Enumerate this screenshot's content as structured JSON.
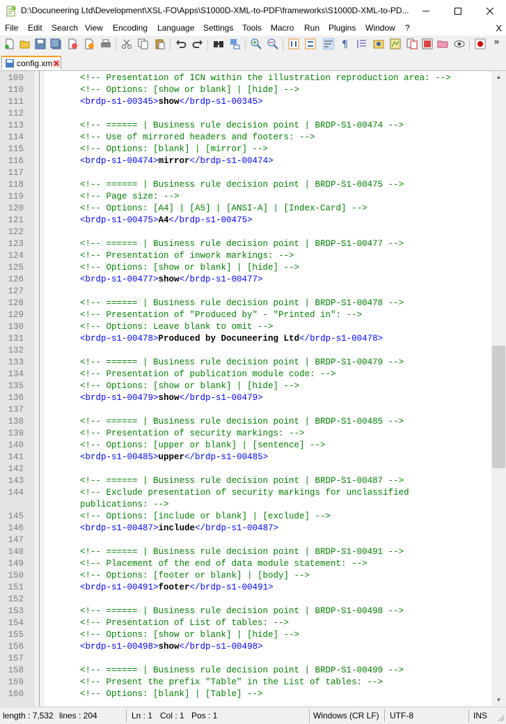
{
  "window": {
    "title": "D:\\Docuneering Ltd\\Development\\XSL-FO\\Apps\\S1000D-XML-to-PDF\\frameworks\\S1000D-XML-to-PD...",
    "minimize_icon": "minimize-icon",
    "maximize_icon": "maximize-icon",
    "close_icon": "close-icon"
  },
  "menu": {
    "items": [
      "File",
      "Edit",
      "Search",
      "View",
      "Encoding",
      "Language",
      "Settings",
      "Tools",
      "Macro",
      "Run",
      "Plugins",
      "Window",
      "?"
    ],
    "close_label": "X"
  },
  "toolbar": {
    "icons": [
      "new-file-icon",
      "open-file-icon",
      "save-icon",
      "save-all-icon",
      "close-icon",
      "close-all-icon",
      "print-icon",
      "cut-icon",
      "copy-icon",
      "paste-icon",
      "undo-icon",
      "redo-icon",
      "find-icon",
      "replace-icon",
      "zoom-in-icon",
      "zoom-out-icon",
      "sync-vertical-icon",
      "sync-horizontal-icon",
      "word-wrap-icon",
      "show-all-chars-icon",
      "indent-guide-icon",
      "udl-icon",
      "doc-map-icon",
      "function-list-icon",
      "folder-workspace-icon",
      "monitoring-icon",
      "record-macro-icon"
    ],
    "overflow": "»"
  },
  "tabs": [
    {
      "label": "config.xml",
      "active": true
    }
  ],
  "editor": {
    "lines": [
      {
        "n": "109",
        "parts": [
          {
            "t": "c",
            "s": "<!-- Presentation of ICN within the illustration reproduction area: -->"
          }
        ]
      },
      {
        "n": "110",
        "parts": [
          {
            "t": "c",
            "s": "<!-- Options: [show or blank] | [hide] -->"
          }
        ]
      },
      {
        "n": "111",
        "parts": [
          {
            "t": "t",
            "s": "<brdp-s1-00345>"
          },
          {
            "t": "v",
            "s": "show"
          },
          {
            "t": "t",
            "s": "</brdp-s1-00345>"
          }
        ]
      },
      {
        "n": "112",
        "parts": []
      },
      {
        "n": "113",
        "parts": [
          {
            "t": "c",
            "s": "<!-- ====== | Business rule decision point | BRDP-S1-00474 -->"
          }
        ]
      },
      {
        "n": "114",
        "parts": [
          {
            "t": "c",
            "s": "<!-- Use of mirrored headers and footers: -->"
          }
        ]
      },
      {
        "n": "115",
        "parts": [
          {
            "t": "c",
            "s": "<!-- Options: [blank] | [mirror] -->"
          }
        ]
      },
      {
        "n": "116",
        "parts": [
          {
            "t": "t",
            "s": "<brdp-s1-00474>"
          },
          {
            "t": "v",
            "s": "mirror"
          },
          {
            "t": "t",
            "s": "</brdp-s1-00474>"
          }
        ]
      },
      {
        "n": "117",
        "parts": []
      },
      {
        "n": "118",
        "parts": [
          {
            "t": "c",
            "s": "<!-- ====== | Business rule decision point | BRDP-S1-00475 -->"
          }
        ]
      },
      {
        "n": "119",
        "parts": [
          {
            "t": "c",
            "s": "<!-- Page size: -->"
          }
        ]
      },
      {
        "n": "120",
        "parts": [
          {
            "t": "c",
            "s": "<!-- Options: [A4] | [A5] | [ANSI-A] | [Index-Card] -->"
          }
        ]
      },
      {
        "n": "121",
        "parts": [
          {
            "t": "t",
            "s": "<brdp-s1-00475>"
          },
          {
            "t": "v",
            "s": "A4"
          },
          {
            "t": "t",
            "s": "</brdp-s1-00475>"
          }
        ]
      },
      {
        "n": "122",
        "parts": []
      },
      {
        "n": "123",
        "parts": [
          {
            "t": "c",
            "s": "<!-- ====== | Business rule decision point | BRDP-S1-00477 -->"
          }
        ]
      },
      {
        "n": "124",
        "parts": [
          {
            "t": "c",
            "s": "<!-- Presentation of inwork markings: -->"
          }
        ]
      },
      {
        "n": "125",
        "parts": [
          {
            "t": "c",
            "s": "<!-- Options: [show or blank] | [hide] -->"
          }
        ]
      },
      {
        "n": "126",
        "parts": [
          {
            "t": "t",
            "s": "<brdp-s1-00477>"
          },
          {
            "t": "v",
            "s": "show"
          },
          {
            "t": "t",
            "s": "</brdp-s1-00477>"
          }
        ]
      },
      {
        "n": "127",
        "parts": []
      },
      {
        "n": "128",
        "parts": [
          {
            "t": "c",
            "s": "<!-- ====== | Business rule decision point | BRDP-S1-00478 -->"
          }
        ]
      },
      {
        "n": "129",
        "parts": [
          {
            "t": "c",
            "s": "<!-- Presentation of \"Produced by\" - \"Printed in\": -->"
          }
        ]
      },
      {
        "n": "130",
        "parts": [
          {
            "t": "c",
            "s": "<!-- Options: Leave blank to omit -->"
          }
        ]
      },
      {
        "n": "131",
        "parts": [
          {
            "t": "t",
            "s": "<brdp-s1-00478>"
          },
          {
            "t": "v",
            "s": "Produced by Docuneering Ltd"
          },
          {
            "t": "t",
            "s": "</brdp-s1-00478>"
          }
        ]
      },
      {
        "n": "132",
        "parts": []
      },
      {
        "n": "133",
        "parts": [
          {
            "t": "c",
            "s": "<!-- ====== | Business rule decision point | BRDP-S1-00479 -->"
          }
        ]
      },
      {
        "n": "134",
        "parts": [
          {
            "t": "c",
            "s": "<!-- Presentation of publication module code: -->"
          }
        ]
      },
      {
        "n": "135",
        "parts": [
          {
            "t": "c",
            "s": "<!-- Options: [show or blank] | [hide] -->"
          }
        ]
      },
      {
        "n": "136",
        "parts": [
          {
            "t": "t",
            "s": "<brdp-s1-00479>"
          },
          {
            "t": "v",
            "s": "show"
          },
          {
            "t": "t",
            "s": "</brdp-s1-00479>"
          }
        ]
      },
      {
        "n": "137",
        "parts": []
      },
      {
        "n": "138",
        "parts": [
          {
            "t": "c",
            "s": "<!-- ====== | Business rule decision point | BRDP-S1-00485 -->"
          }
        ]
      },
      {
        "n": "139",
        "parts": [
          {
            "t": "c",
            "s": "<!-- Presentation of security markings: -->"
          }
        ]
      },
      {
        "n": "140",
        "parts": [
          {
            "t": "c",
            "s": "<!-- Options: [upper or blank] | [sentence] -->"
          }
        ]
      },
      {
        "n": "141",
        "parts": [
          {
            "t": "t",
            "s": "<brdp-s1-00485>"
          },
          {
            "t": "v",
            "s": "upper"
          },
          {
            "t": "t",
            "s": "</brdp-s1-00485>"
          }
        ]
      },
      {
        "n": "142",
        "parts": []
      },
      {
        "n": "143",
        "parts": [
          {
            "t": "c",
            "s": "<!-- ====== | Business rule decision point | BRDP-S1-00487 -->"
          }
        ]
      },
      {
        "n": "144",
        "parts": [
          {
            "t": "c",
            "s": "<!-- Exclude presentation of security markings for unclassified"
          }
        ]
      },
      {
        "n": "",
        "parts": [
          {
            "t": "c",
            "s": "publications: -->"
          }
        ]
      },
      {
        "n": "145",
        "parts": [
          {
            "t": "c",
            "s": "<!-- Options: [include or blank] | [exclude] -->"
          }
        ]
      },
      {
        "n": "146",
        "parts": [
          {
            "t": "t",
            "s": "<brdp-s1-00487>"
          },
          {
            "t": "v",
            "s": "include"
          },
          {
            "t": "t",
            "s": "</brdp-s1-00487>"
          }
        ]
      },
      {
        "n": "147",
        "parts": []
      },
      {
        "n": "148",
        "parts": [
          {
            "t": "c",
            "s": "<!-- ====== | Business rule decision point | BRDP-S1-00491 -->"
          }
        ]
      },
      {
        "n": "149",
        "parts": [
          {
            "t": "c",
            "s": "<!-- Placement of the end of data module statement: -->"
          }
        ]
      },
      {
        "n": "150",
        "parts": [
          {
            "t": "c",
            "s": "<!-- Options: [footer or blank] | [body] -->"
          }
        ]
      },
      {
        "n": "151",
        "parts": [
          {
            "t": "t",
            "s": "<brdp-s1-00491>"
          },
          {
            "t": "v",
            "s": "footer"
          },
          {
            "t": "t",
            "s": "</brdp-s1-00491>"
          }
        ]
      },
      {
        "n": "152",
        "parts": []
      },
      {
        "n": "153",
        "parts": [
          {
            "t": "c",
            "s": "<!-- ====== | Business rule decision point | BRDP-S1-00498 -->"
          }
        ]
      },
      {
        "n": "154",
        "parts": [
          {
            "t": "c",
            "s": "<!-- Presentation of List of tables: -->"
          }
        ]
      },
      {
        "n": "155",
        "parts": [
          {
            "t": "c",
            "s": "<!-- Options: [show or blank] | [hide] -->"
          }
        ]
      },
      {
        "n": "156",
        "parts": [
          {
            "t": "t",
            "s": "<brdp-s1-00498>"
          },
          {
            "t": "v",
            "s": "show"
          },
          {
            "t": "t",
            "s": "</brdp-s1-00498>"
          }
        ]
      },
      {
        "n": "157",
        "parts": []
      },
      {
        "n": "158",
        "parts": [
          {
            "t": "c",
            "s": "<!-- ====== | Business rule decision point | BRDP-S1-00499 -->"
          }
        ]
      },
      {
        "n": "159",
        "parts": [
          {
            "t": "c",
            "s": "<!-- Present the prefix \"Table\" in the List of tables: -->"
          }
        ]
      },
      {
        "n": "160",
        "parts": [
          {
            "t": "c",
            "s": "<!-- Options: [blank] | [Table] -->"
          }
        ]
      }
    ]
  },
  "scrollbar": {
    "position_fraction": 0.43,
    "visible_fraction": 0.2
  },
  "status": {
    "length": "length : 7,532",
    "lines": "lines : 204",
    "ln": "Ln : 1",
    "col": "Col : 1",
    "pos": "Pos : 1",
    "eol": "Windows (CR LF)",
    "encoding": "UTF-8",
    "mode": "INS"
  },
  "colors": {
    "comment": "#008000",
    "tag": "#0000ff",
    "value": "#000000",
    "tab_accent": "#fa9b20"
  }
}
